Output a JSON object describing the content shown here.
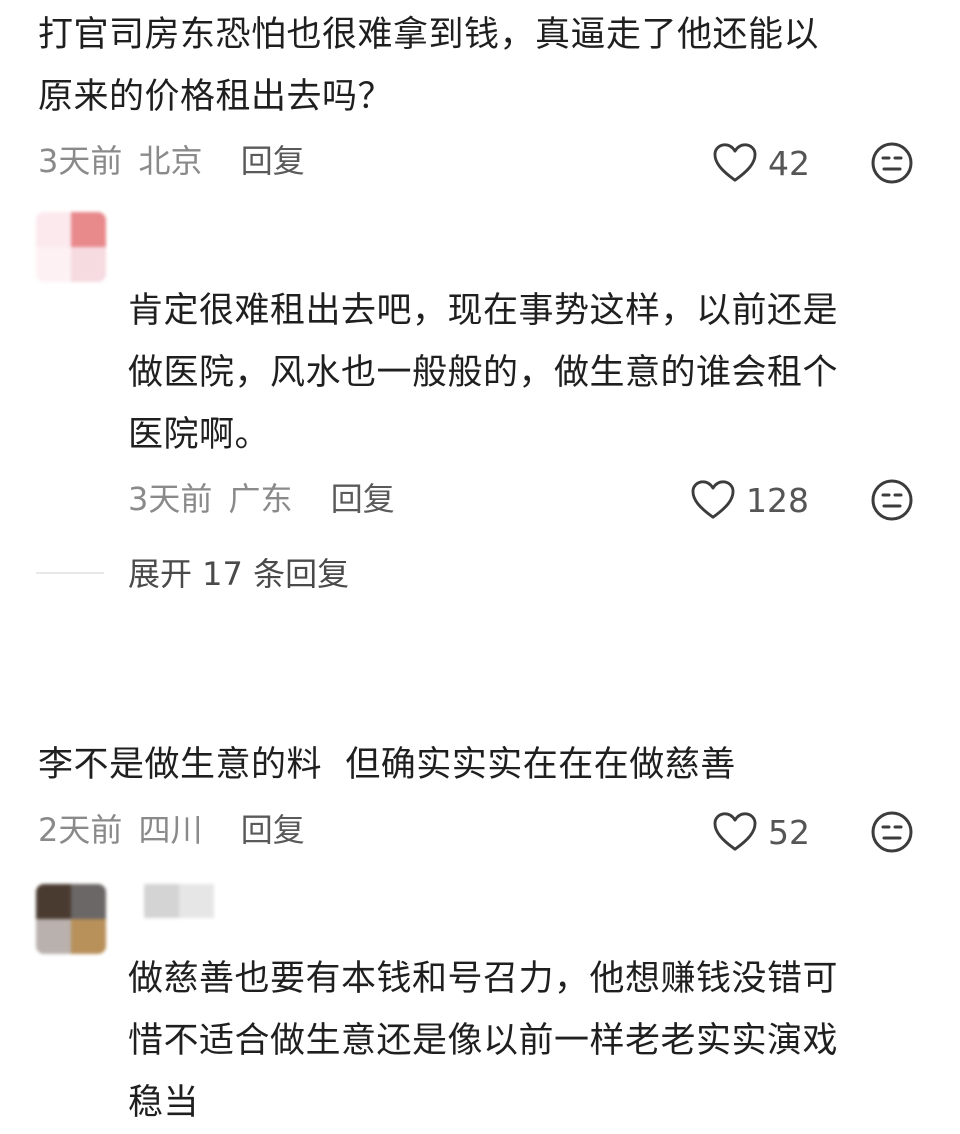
{
  "comments": [
    {
      "text_lines": [
        "打官司房东恐怕也很难拿到钱，真逼走了他还能以",
        "原来的价格租出去吗？"
      ],
      "time": "3天前",
      "location": "北京",
      "reply_label": "回复",
      "likes": "42",
      "reply": {
        "text_lines": [
          "肯定很难租出去吧，现在事势这样，以前还是",
          "做医院，风水也一般般的，做生意的谁会租个",
          "医院啊。"
        ],
        "time": "3天前",
        "location": "广东",
        "reply_label": "回复",
        "likes": "128"
      },
      "expand_label": "展开 17 条回复"
    },
    {
      "text_lines": [
        "李不是做生意的料  但确实实实在在在做慈善"
      ],
      "time": "2天前",
      "location": "四川",
      "reply_label": "回复",
      "likes": "52",
      "reply": {
        "text_lines": [
          "做慈善也要有本钱和号召力，他想赚钱没错可",
          "惜不适合做生意还是像以前一样老老实实演戏",
          "稳当"
        ]
      }
    }
  ],
  "icons": {
    "like": "heart-outline-icon",
    "emoji": "neutral-face-icon"
  },
  "colors": {
    "text": "#1f1f1f",
    "meta": "#8a8a8a",
    "avatar_pink": "#e8898c"
  }
}
